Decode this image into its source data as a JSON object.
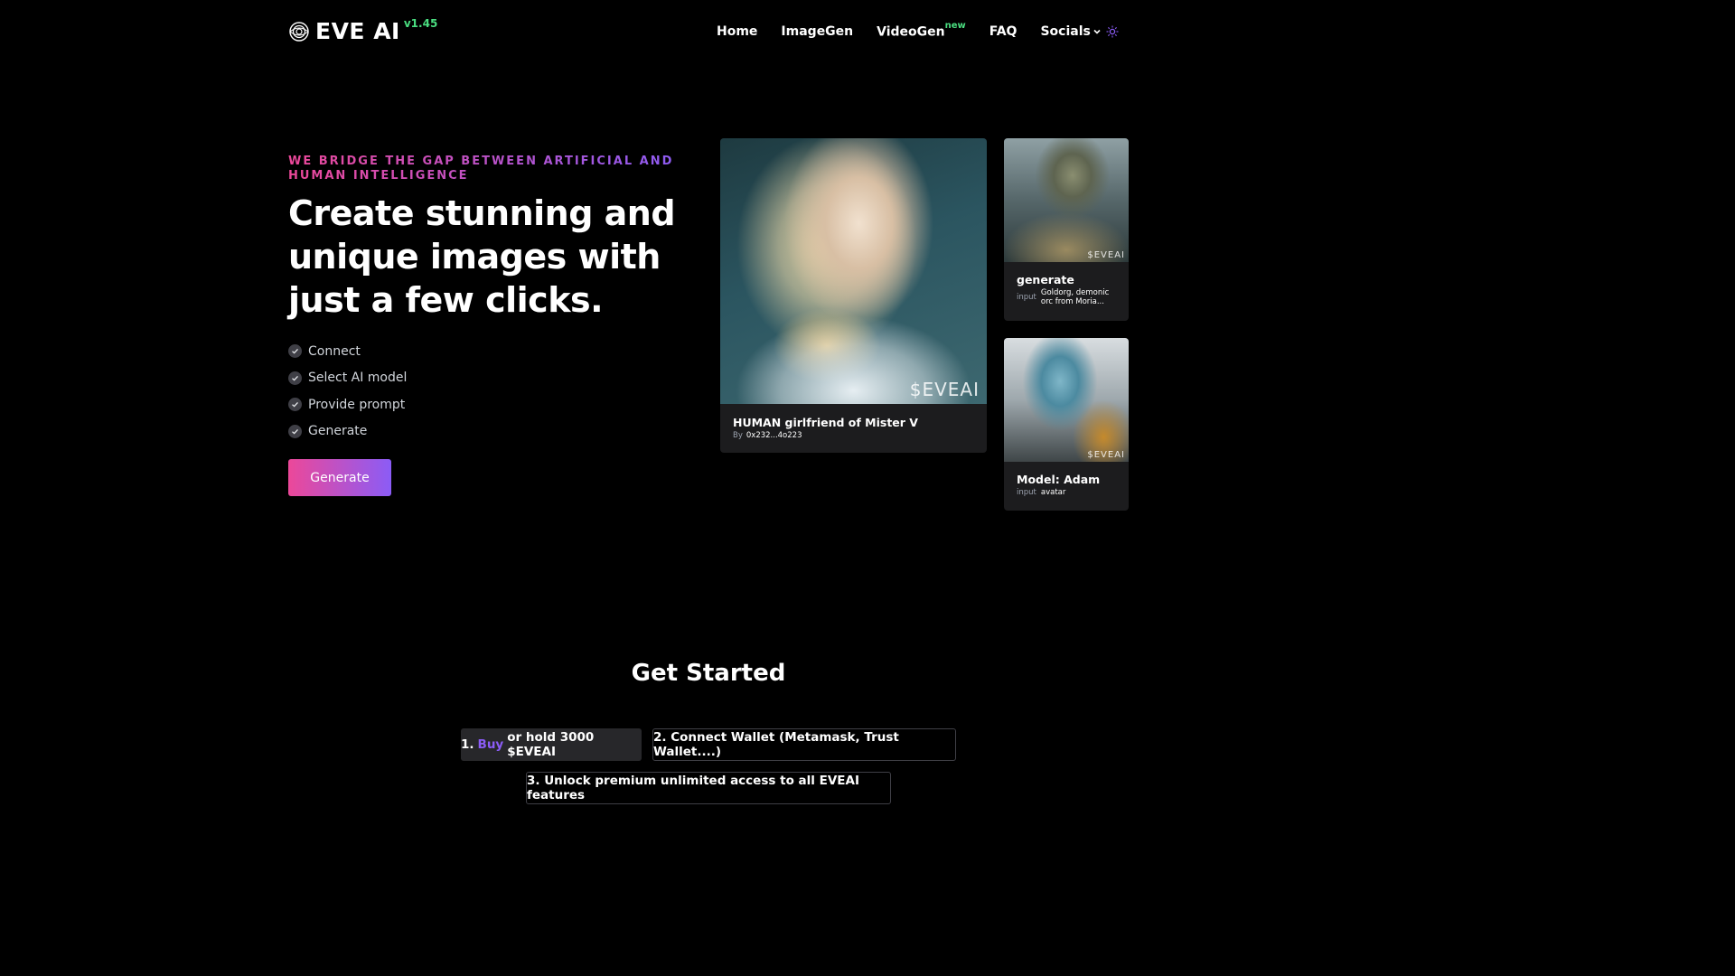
{
  "brand": {
    "name": "EVE AI",
    "version": "v1.45"
  },
  "nav": {
    "items": [
      {
        "label": "Home"
      },
      {
        "label": "ImageGen"
      },
      {
        "label": "VideoGen",
        "badge": "new"
      },
      {
        "label": "FAQ"
      },
      {
        "label": "Socials"
      }
    ]
  },
  "hero": {
    "tagline": "WE BRIDGE THE GAP BETWEEN ARTIFICIAL AND HUMAN INTELLIGENCE",
    "headline": "Create stunning and unique images with just a few clicks.",
    "steps": [
      "Connect",
      "Select AI model",
      "Provide prompt",
      "Generate"
    ],
    "cta": "Generate"
  },
  "cards": {
    "main": {
      "title": "HUMAN girlfriend of Mister V",
      "by_label": "By",
      "by_value": "0x232...4o223",
      "watermark": "$EVEAI"
    },
    "card1": {
      "title": "generate",
      "input_label": "input",
      "input_value": "Goldorg, demonic orc from Moria...",
      "watermark": "$EVEAI"
    },
    "card2": {
      "title": "Model: Adam",
      "input_label": "input",
      "input_value": "avatar",
      "watermark": "$EVEAI"
    }
  },
  "get_started": {
    "title": "Get Started",
    "step1_prefix": "1.",
    "step1_link": "Buy",
    "step1_suffix": "or hold 3000 $EVEAI",
    "step2": "2. Connect Wallet (Metamask, Trust Wallet....)",
    "step3": "3. Unlock premium unlimited access to all EVEAI features"
  },
  "colors": {
    "accent_pink": "#ec4899",
    "accent_purple": "#8b5cf6",
    "version_green": "#4ade80",
    "background": "#000000"
  },
  "icons": {
    "logo": "eye-spiral-icon",
    "check": "check-circle-icon",
    "chevron": "chevron-down-icon",
    "theme": "sun-icon"
  }
}
